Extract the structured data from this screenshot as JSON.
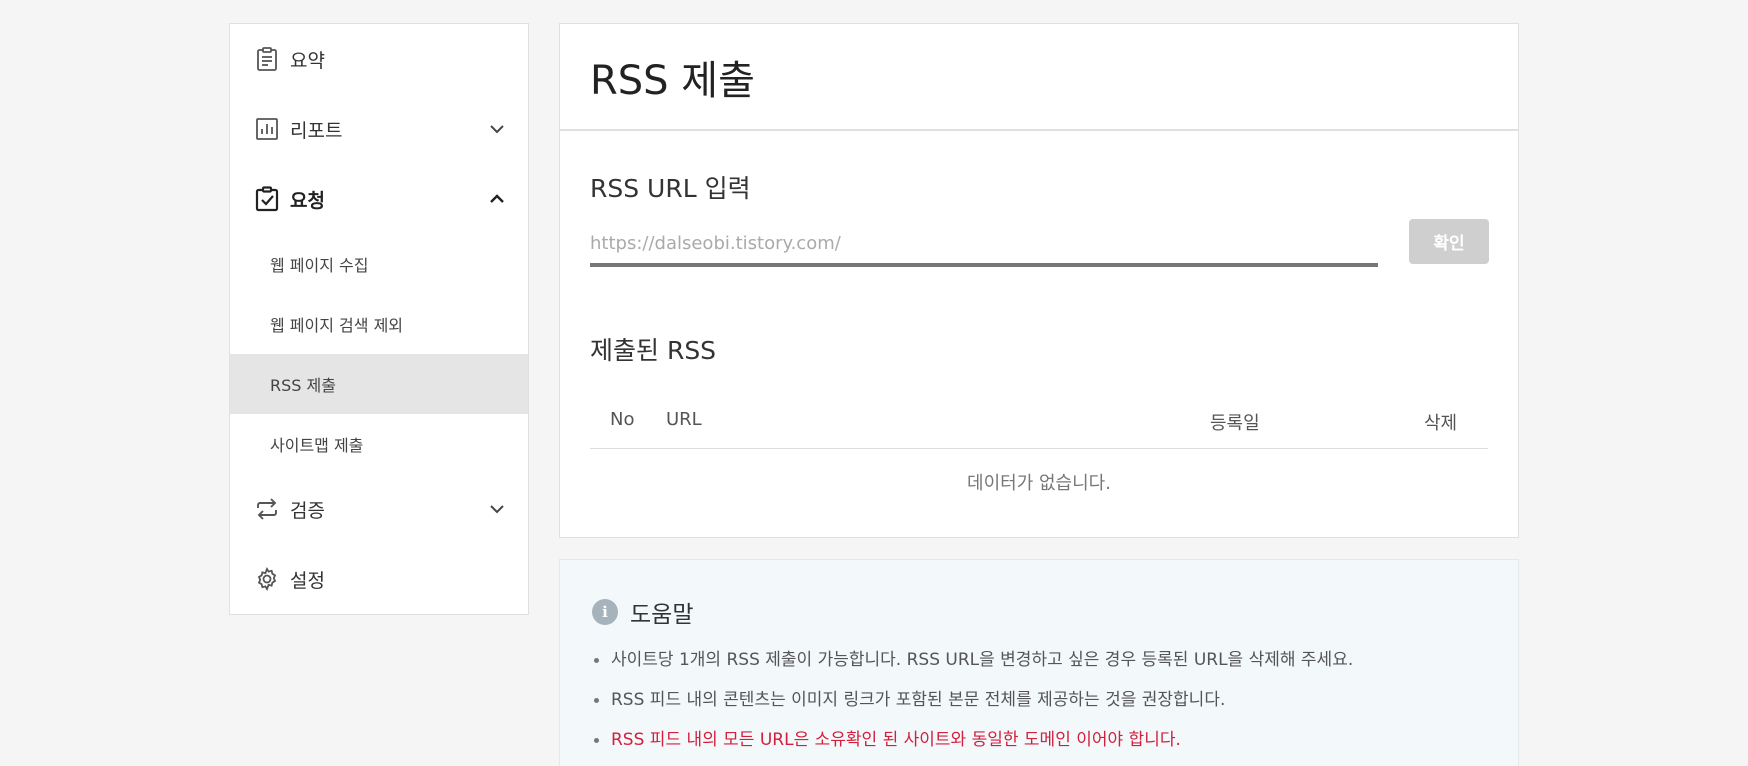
{
  "sidebar": {
    "summary": "요약",
    "report": "리포트",
    "request": "요청",
    "request_items": [
      "웹 페이지 수집",
      "웹 페이지 검색 제외",
      "RSS 제출",
      "사이트맵 제출"
    ],
    "verify": "검증",
    "settings": "설정",
    "active_item": "RSS 제출"
  },
  "main": {
    "title": "RSS 제출",
    "url_section_label": "RSS URL 입력",
    "url_placeholder": "https://dalseobi.tistory.com/",
    "confirm_label": "확인",
    "submitted_label": "제출된 RSS",
    "columns": [
      "No",
      "URL",
      "등록일",
      "삭제"
    ],
    "empty_message": "데이터가 없습니다."
  },
  "help": {
    "title": "도움말",
    "info_glyph": "i",
    "items": [
      "사이트당 1개의 RSS 제출이 가능합니다. RSS URL을 변경하고 싶은 경우 등록된 URL을 삭제해 주세요.",
      "RSS 피드 내의 콘텐츠는 이미지 링크가 포함된 본문 전체를 제공하는 것을 권장합니다.",
      "RSS 피드 내의 모든 URL은 소유확인 된 사이트와 동일한 도메인 이어야 합니다."
    ],
    "warn_color": "#d21f3c"
  }
}
